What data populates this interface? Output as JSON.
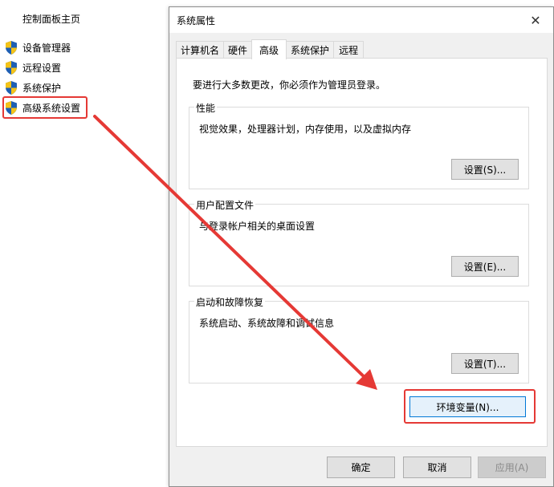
{
  "sidebar": {
    "home": "控制面板主页",
    "items": [
      {
        "label": "设备管理器",
        "icon": "uac-shield-icon"
      },
      {
        "label": "远程设置",
        "icon": "uac-shield-icon"
      },
      {
        "label": "系统保护",
        "icon": "uac-shield-icon"
      },
      {
        "label": "高级系统设置",
        "icon": "uac-shield-icon"
      }
    ]
  },
  "dialog": {
    "title": "系统属性",
    "close": "✕",
    "tabs": [
      "计算机名",
      "硬件",
      "高级",
      "系统保护",
      "远程"
    ],
    "active_tab": "高级",
    "admin_note": "要进行大多数更改，你必须作为管理员登录。",
    "groups": [
      {
        "title": "性能",
        "desc": "视觉效果，处理器计划，内存使用，以及虚拟内存",
        "button": "设置(S)..."
      },
      {
        "title": "用户配置文件",
        "desc": "与登录帐户相关的桌面设置",
        "button": "设置(E)..."
      },
      {
        "title": "启动和故障恢复",
        "desc": "系统启动、系统故障和调试信息",
        "button": "设置(T)..."
      }
    ],
    "env_button": "环境变量(N)...",
    "ok": "确定",
    "cancel": "取消",
    "apply": "应用(A)"
  },
  "annotation_color": "#e53935"
}
